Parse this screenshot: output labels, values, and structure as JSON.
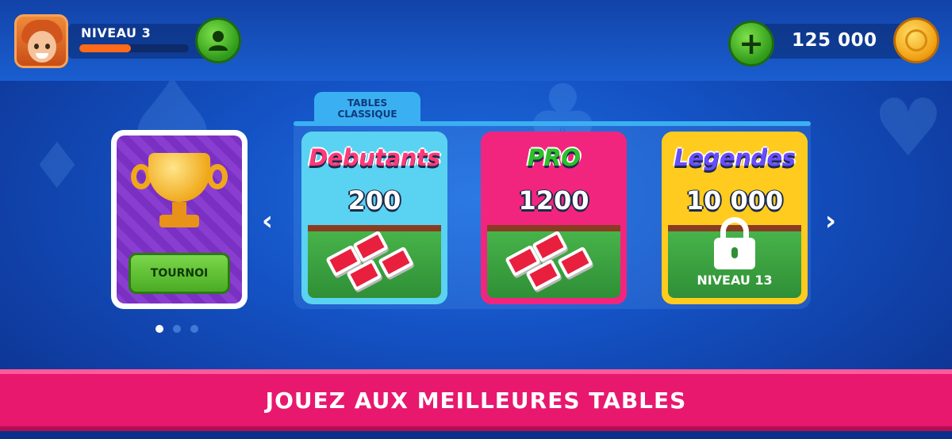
{
  "player": {
    "level_label": "NIVEAU 3",
    "xp_progress": 0.47
  },
  "wallet": {
    "coins": "125 000"
  },
  "section": {
    "tab_label_line1": "TABLES",
    "tab_label_line2": "CLASSIQUE"
  },
  "tournament": {
    "button_label": "TOURNOI"
  },
  "tables": [
    {
      "title": "Debutants",
      "price": "200",
      "title_color": "#ff3a7a",
      "bg_color": "#5ad2f2",
      "locked": false
    },
    {
      "title": "PRO",
      "price": "1200",
      "title_color": "#2fbf2a",
      "bg_color": "#f2257e",
      "locked": false
    },
    {
      "title": "Legendes",
      "price": "10 000",
      "title_color": "#6a4cff",
      "bg_color": "#ffcb1e",
      "locked": true,
      "lock_text": "NIVEAU 13"
    }
  ],
  "pagination": {
    "pages": 3,
    "active": 1
  },
  "banner": {
    "text": "JOUEZ AUX MEILLEURES TABLES"
  },
  "icons": {
    "profile": "user-icon",
    "add_coins": "plus-icon",
    "coin": "coin-icon",
    "prev": "chevron-left-icon",
    "next": "chevron-right-icon",
    "trophy": "trophy-icon",
    "lock": "lock-icon"
  },
  "colors": {
    "accent_green": "#4aac24",
    "banner_pink": "#e8186f",
    "xp_orange": "#ff6a1a",
    "background_blue": "#1452c4"
  }
}
